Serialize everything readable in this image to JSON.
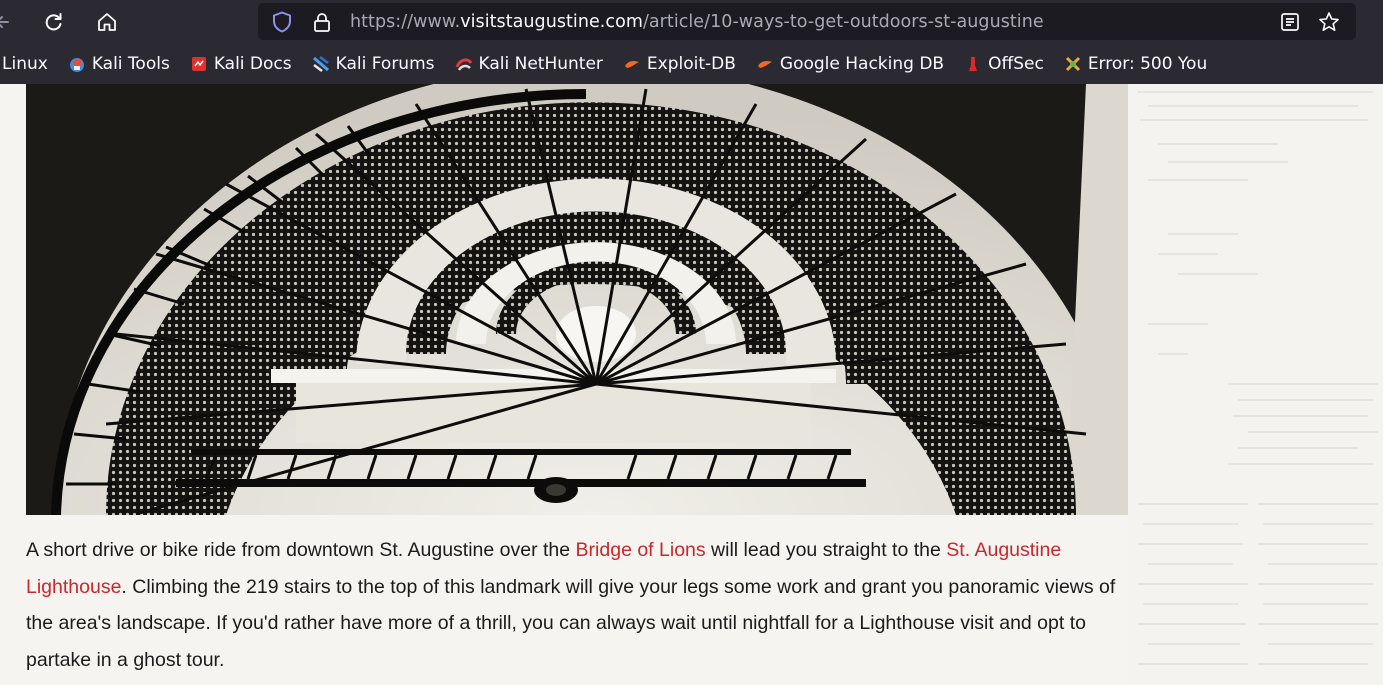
{
  "browser": {
    "url_protocol": "https://www.",
    "url_host": "visitstaugustine.com",
    "url_path": "/article/10-ways-to-get-outdoors-st-augustine",
    "icons": [
      "back-arrow-icon",
      "reload-icon",
      "home-icon",
      "shield-icon",
      "lock-icon",
      "reader-view-icon",
      "bookmark-star-icon"
    ]
  },
  "bookmarks": [
    {
      "label": "Linux",
      "icon": "none"
    },
    {
      "label": "Kali Tools",
      "icon": "kali-tools-icon"
    },
    {
      "label": "Kali Docs",
      "icon": "kali-docs-icon"
    },
    {
      "label": "Kali Forums",
      "icon": "kali-forums-icon"
    },
    {
      "label": "Kali NetHunter",
      "icon": "nethunter-icon"
    },
    {
      "label": "Exploit-DB",
      "icon": "exploit-db-icon"
    },
    {
      "label": "Google Hacking DB",
      "icon": "ghdb-icon"
    },
    {
      "label": "OffSec",
      "icon": "offsec-icon"
    },
    {
      "label": "Error: 500 You",
      "icon": "error-icon"
    }
  ],
  "article": {
    "p1": "A short drive or bike ride from downtown St. Augustine over the ",
    "link1": "Bridge of Lions",
    "p2": " will lead you straight to the ",
    "link2": "St. Augustine Lighthouse",
    "p3": ". Climbing the 219 stairs to the top of this landmark will give your legs some work and grant you panoramic views of the area's landscape. If you'd rather have more of a thrill, you can always wait until nightfall for a Lighthouse visit and opt to partake in a ghost tour."
  },
  "colors": {
    "chrome_bg": "#2b2a33",
    "urlbar_bg": "#1c1b22",
    "link": "#c8282c",
    "text": "#1b1b1b"
  }
}
